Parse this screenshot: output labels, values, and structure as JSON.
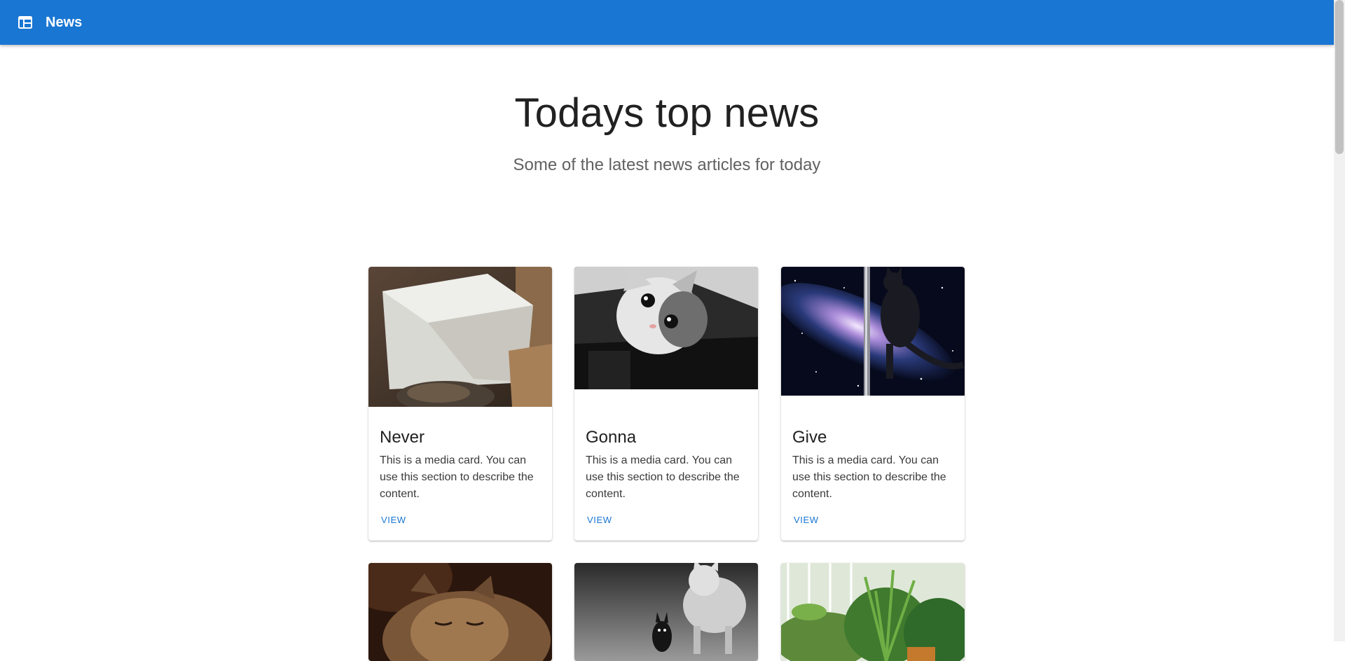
{
  "appbar": {
    "title": "News",
    "icon": "view-quilt-icon"
  },
  "hero": {
    "title": "Todays top news",
    "subtitle": "Some of the latest news articles for today"
  },
  "cards": [
    {
      "title": "Never",
      "text": "This is a media card. You can use this section to describe the content.",
      "action": "VIEW",
      "image": "cat-in-box-photo"
    },
    {
      "title": "Gonna",
      "text": "This is a media card. You can use this section to describe the content.",
      "action": "VIEW",
      "image": "kitten-closeup-photo"
    },
    {
      "title": "Give",
      "text": "This is a media card. You can use this section to describe the content.",
      "action": "VIEW",
      "image": "cat-on-pole-galaxy-photo"
    },
    {
      "image": "sleeping-kitten-photo"
    },
    {
      "image": "cat-with-totoro-bw-photo"
    },
    {
      "image": "garden-plants-photo"
    }
  ],
  "colors": {
    "primary": "#1976d2",
    "background": "#ffffff"
  }
}
